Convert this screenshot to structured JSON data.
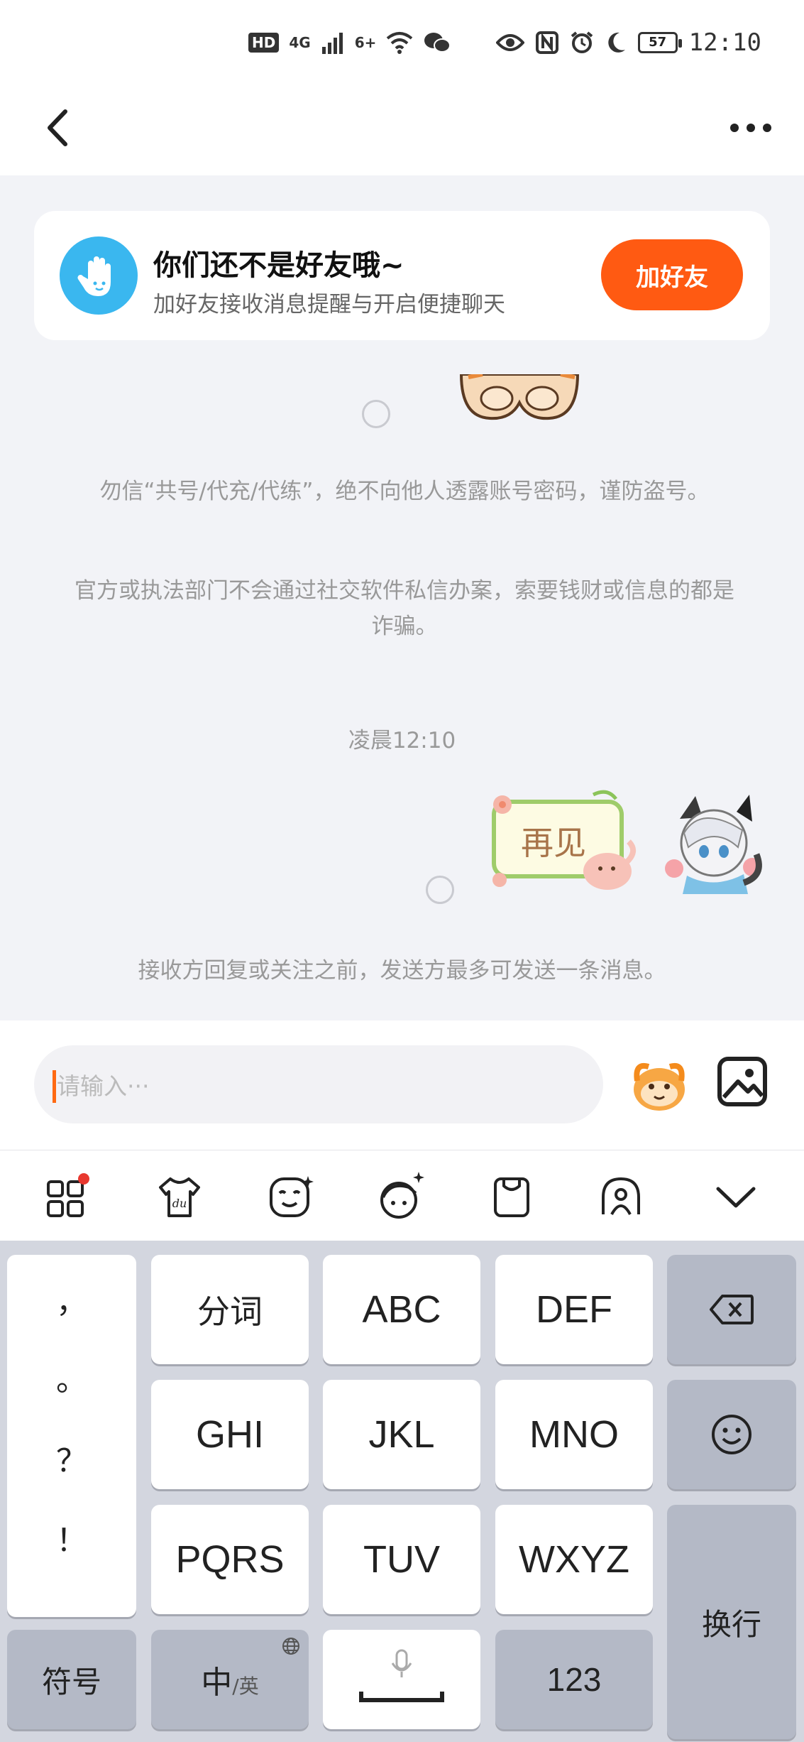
{
  "status_bar": {
    "left_badges": [
      "HD",
      "4G",
      "6+"
    ],
    "battery": "57",
    "time": "12:10"
  },
  "friend_card": {
    "title": "你们还不是好友哦~",
    "subtitle": "加好友接收消息提醒与开启便捷聊天",
    "add_button": "加好友"
  },
  "chat": {
    "notice_1": "勿信“共号/代充/代练”，绝不向他人透露账号密码，谨防盗号。",
    "notice_2": "官方或执法部门不会通过社交软件私信办案，索要钱财或信息的都是诈骗。",
    "time_label": "凌晨12:10",
    "sticker_text": "再见",
    "notice_3": "接收方回复或关注之前，发送方最多可发送一条消息。"
  },
  "input": {
    "placeholder": "请输入···"
  },
  "keyboard": {
    "punct": [
      "，",
      "。",
      "？",
      "！"
    ],
    "keys": {
      "fenci": "分词",
      "abc": "ABC",
      "def": "DEF",
      "ghi": "GHI",
      "jkl": "JKL",
      "mno": "MNO",
      "pqrs": "PQRS",
      "tuv": "TUV",
      "wxyz": "WXYZ",
      "symbol": "符号",
      "lang_main": "中",
      "lang_sub": "/英",
      "num": "123",
      "enter": "换行"
    }
  },
  "colors": {
    "accent": "#ff5a12",
    "avatar_blue": "#3ab7ef",
    "notice_text": "#999999"
  }
}
